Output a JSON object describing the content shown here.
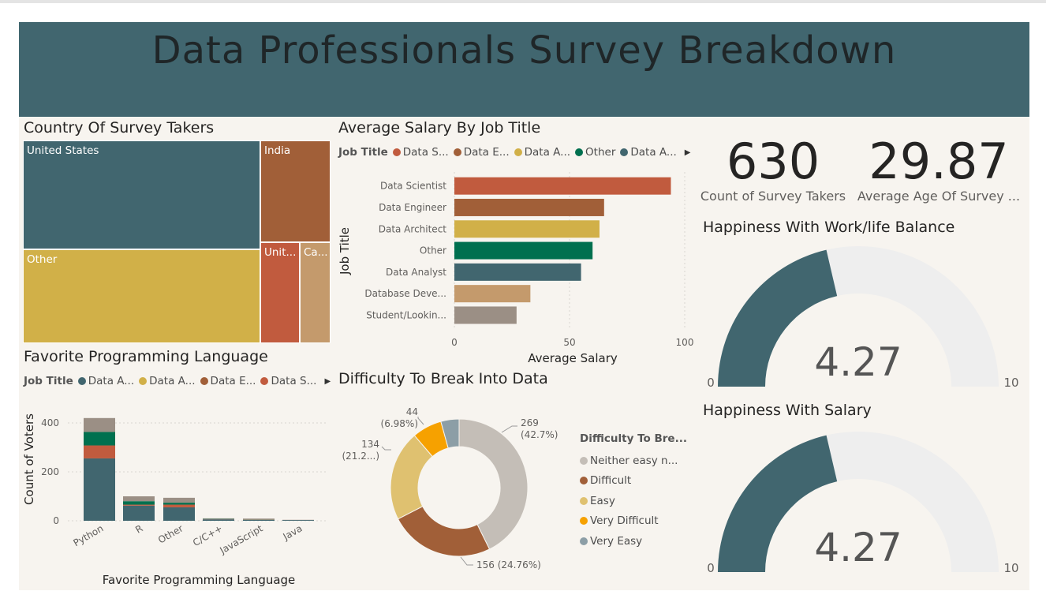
{
  "header": {
    "title": "Data Professionals Survey Breakdown"
  },
  "colors": {
    "teal": "#41666f",
    "mustard": "#d1b048",
    "rust": "#c15b3e",
    "brown": "#a15f38",
    "tan": "#c49a6c",
    "green": "#00704f",
    "taupe": "#9b8f85",
    "lightgray": "#c4beb7",
    "paleyellow": "#dfc170",
    "orange": "#f6a100",
    "steel": "#8c9ea6",
    "gauge_bg": "#eeeeee"
  },
  "treemap": {
    "title": "Country Of Survey Takers",
    "cells": [
      {
        "label": "United States",
        "color": "#41666f"
      },
      {
        "label": "Other",
        "color": "#d1b048"
      },
      {
        "label": "India",
        "color": "#a15f38"
      },
      {
        "label": "Unit...",
        "color": "#c15b3e"
      },
      {
        "label": "Ca...",
        "color": "#c49a6c"
      }
    ]
  },
  "salary_chart": {
    "title": "Average Salary By Job Title",
    "legend_title": "Job Title",
    "legend": [
      {
        "label": "Data S...",
        "color": "#c15b3e"
      },
      {
        "label": "Data E...",
        "color": "#a15f38"
      },
      {
        "label": "Data A...",
        "color": "#d1b048"
      },
      {
        "label": "Other",
        "color": "#00704f"
      },
      {
        "label": "Data A...",
        "color": "#41666f"
      }
    ]
  },
  "language_chart": {
    "title": "Favorite Programming Language",
    "legend_title": "Job Title",
    "legend": [
      {
        "label": "Data A...",
        "color": "#41666f"
      },
      {
        "label": "Data A...",
        "color": "#d1b048"
      },
      {
        "label": "Data E...",
        "color": "#a15f38"
      },
      {
        "label": "Data S...",
        "color": "#c15b3e"
      }
    ]
  },
  "difficulty_chart": {
    "title": "Difficulty To Break Into Data",
    "legend_title": "Difficulty To Bre...",
    "data_labels": [
      "269",
      "(42.7%)",
      "156 (24.76%)",
      "134",
      "(21.2...)",
      "44",
      "(6.98%)"
    ]
  },
  "kpis": [
    {
      "value": "630",
      "label": "Count of Survey Takers"
    },
    {
      "value": "29.87",
      "label": "Average Age Of Survey ..."
    }
  ],
  "gauges": [
    {
      "title": "Happiness With Work/life Balance",
      "value": 4.27,
      "value_label": "4.27",
      "min": 0,
      "max": 10,
      "min_label": "0",
      "max_label": "10"
    },
    {
      "title": "Happiness With Salary",
      "value": 4.27,
      "value_label": "4.27",
      "min": 0,
      "max": 10,
      "min_label": "0",
      "max_label": "10"
    }
  ],
  "chart_data": [
    {
      "type": "treemap",
      "title": "Country Of Survey Takers",
      "categories": [
        "United States",
        "Other",
        "India",
        "United Kingdom",
        "Canada"
      ],
      "values": [
        262,
        226,
        76,
        32,
        24
      ]
    },
    {
      "type": "bar",
      "orientation": "horizontal",
      "title": "Average Salary By Job Title",
      "categories": [
        "Data Scientist",
        "Data Engineer",
        "Data Architect",
        "Other",
        "Data Analyst",
        "Database Deve...",
        "Student/Lookin..."
      ],
      "values": [
        94,
        65,
        63,
        60,
        55,
        33,
        27
      ],
      "colors": [
        "#c15b3e",
        "#a15f38",
        "#d1b048",
        "#00704f",
        "#41666f",
        "#c49a6c",
        "#9b8f85"
      ],
      "xlabel": "Average Salary",
      "ylabel": "Job Title",
      "xlim": [
        0,
        100
      ],
      "xticks": [
        "0",
        "50",
        "100"
      ],
      "grid": true
    },
    {
      "type": "bar",
      "stacked": true,
      "title": "Favorite Programming Language",
      "categories": [
        "Python",
        "R",
        "Other",
        "C/C++",
        "JavaScript",
        "Java"
      ],
      "xlabel": "Favorite Programming Language",
      "ylabel": "Count of Voters",
      "ylim": [
        0,
        450
      ],
      "yticks": [
        "0",
        "200",
        "400"
      ],
      "series": [
        {
          "values": [
            255,
            62,
            55,
            6,
            4,
            3
          ],
          "color": "#41666f"
        },
        {
          "values": [
            0,
            0,
            0,
            0,
            0,
            0
          ],
          "color": "#d1b048"
        },
        {
          "values": [
            53,
            4,
            11,
            1,
            1,
            0
          ],
          "color": "#c15b3e"
        },
        {
          "values": [
            55,
            14,
            8,
            1,
            1,
            0
          ],
          "color": "#00704f"
        },
        {
          "values": [
            57,
            20,
            20,
            2,
            3,
            1
          ],
          "color": "#9b8f85"
        }
      ]
    },
    {
      "type": "pie",
      "donut": true,
      "title": "Difficulty To Break Into Data",
      "categories": [
        "Neither easy n...",
        "Difficult",
        "Easy",
        "Very Difficult",
        "Very Easy"
      ],
      "values": [
        269,
        156,
        134,
        44,
        27
      ],
      "colors": [
        "#c4beb7",
        "#a15f38",
        "#dfc170",
        "#f6a100",
        "#8c9ea6"
      ]
    }
  ]
}
